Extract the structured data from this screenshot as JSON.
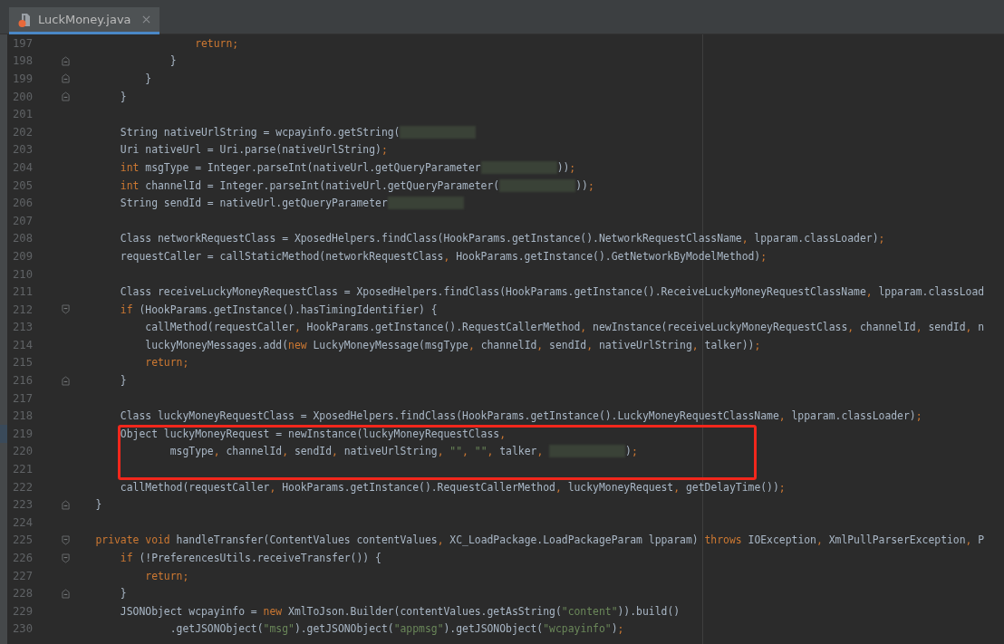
{
  "tab": {
    "title": "LuckMoney.java",
    "selected": true
  },
  "lines": [
    {
      "number": "197",
      "segments": [
        {
          "kind": "keyword",
          "text": "                    return"
        },
        {
          "kind": "punct",
          "text": ";"
        }
      ]
    },
    {
      "number": "198",
      "fold_close": true,
      "segments": [
        {
          "kind": "plain",
          "text": "                }"
        }
      ]
    },
    {
      "number": "199",
      "fold_close": true,
      "segments": [
        {
          "kind": "plain",
          "text": "            }"
        }
      ]
    },
    {
      "number": "200",
      "fold_close": true,
      "segments": [
        {
          "kind": "plain",
          "text": "        }"
        }
      ]
    },
    {
      "number": "201"
    },
    {
      "number": "202",
      "segments": [
        {
          "kind": "plain",
          "text": "        String nativeUrlString = wcpayinfo.getString("
        },
        {
          "kind": "redacted"
        }
      ]
    },
    {
      "number": "203",
      "segments": [
        {
          "kind": "plain",
          "text": "        Uri nativeUrl = Uri.parse(nativeUrlString)"
        },
        {
          "kind": "punct",
          "text": ";"
        }
      ]
    },
    {
      "number": "204",
      "segments": [
        {
          "kind": "keyword",
          "text": "        int"
        },
        {
          "kind": "plain",
          "text": " msgType = Integer.parseInt(nativeUrl.getQueryParameter"
        },
        {
          "kind": "redacted"
        },
        {
          "kind": "plain",
          "text": "))"
        },
        {
          "kind": "punct",
          "text": ";"
        }
      ]
    },
    {
      "number": "205",
      "segments": [
        {
          "kind": "keyword",
          "text": "        int"
        },
        {
          "kind": "plain",
          "text": " channelId = Integer.parseInt(nativeUrl.getQueryParameter("
        },
        {
          "kind": "redacted"
        },
        {
          "kind": "plain",
          "text": "))"
        },
        {
          "kind": "punct",
          "text": ";"
        }
      ]
    },
    {
      "number": "206",
      "segments": [
        {
          "kind": "plain",
          "text": "        String sendId = nativeUrl.getQueryParameter"
        },
        {
          "kind": "redacted"
        }
      ]
    },
    {
      "number": "207"
    },
    {
      "number": "208",
      "segments": [
        {
          "kind": "plain",
          "text": "        Class networkRequestClass = XposedHelpers.findClass(HookParams.getInstance().NetworkRequestClassName"
        },
        {
          "kind": "punct",
          "text": ","
        },
        {
          "kind": "plain",
          "text": " lpparam.classLoader)"
        },
        {
          "kind": "punct",
          "text": ";"
        }
      ]
    },
    {
      "number": "209",
      "segments": [
        {
          "kind": "plain",
          "text": "        requestCaller = callStaticMethod(networkRequestClass"
        },
        {
          "kind": "punct",
          "text": ","
        },
        {
          "kind": "plain",
          "text": " HookParams.getInstance().GetNetworkByModelMethod)"
        },
        {
          "kind": "punct",
          "text": ";"
        }
      ]
    },
    {
      "number": "210"
    },
    {
      "number": "211",
      "segments": [
        {
          "kind": "plain",
          "text": "        Class receiveLuckyMoneyRequestClass = XposedHelpers.findClass(HookParams.getInstance().ReceiveLuckyMoneyRequestClassName"
        },
        {
          "kind": "punct",
          "text": ","
        },
        {
          "kind": "plain",
          "text": " lpparam.classLoad"
        }
      ]
    },
    {
      "number": "212",
      "fold_open": true,
      "segments": [
        {
          "kind": "keyword",
          "text": "        if"
        },
        {
          "kind": "plain",
          "text": " (HookParams.getInstance().hasTimingIdentifier) {"
        }
      ]
    },
    {
      "number": "213",
      "segments": [
        {
          "kind": "plain",
          "text": "            callMethod(requestCaller"
        },
        {
          "kind": "punct",
          "text": ","
        },
        {
          "kind": "plain",
          "text": " HookParams.getInstance().RequestCallerMethod"
        },
        {
          "kind": "punct",
          "text": ","
        },
        {
          "kind": "plain",
          "text": " newInstance(receiveLuckyMoneyRequestClass"
        },
        {
          "kind": "punct",
          "text": ","
        },
        {
          "kind": "plain",
          "text": " channelId"
        },
        {
          "kind": "punct",
          "text": ","
        },
        {
          "kind": "plain",
          "text": " sendId"
        },
        {
          "kind": "punct",
          "text": ","
        },
        {
          "kind": "plain",
          "text": " n"
        }
      ]
    },
    {
      "number": "214",
      "segments": [
        {
          "kind": "plain",
          "text": "            luckyMoneyMessages.add("
        },
        {
          "kind": "keyword",
          "text": "new"
        },
        {
          "kind": "plain",
          "text": " LuckyMoneyMessage(msgType"
        },
        {
          "kind": "punct",
          "text": ","
        },
        {
          "kind": "plain",
          "text": " channelId"
        },
        {
          "kind": "punct",
          "text": ","
        },
        {
          "kind": "plain",
          "text": " sendId"
        },
        {
          "kind": "punct",
          "text": ","
        },
        {
          "kind": "plain",
          "text": " nativeUrlString"
        },
        {
          "kind": "punct",
          "text": ","
        },
        {
          "kind": "plain",
          "text": " talker))"
        },
        {
          "kind": "punct",
          "text": ";"
        }
      ]
    },
    {
      "number": "215",
      "segments": [
        {
          "kind": "keyword",
          "text": "            return"
        },
        {
          "kind": "punct",
          "text": ";"
        }
      ]
    },
    {
      "number": "216",
      "fold_close": true,
      "segments": [
        {
          "kind": "plain",
          "text": "        }"
        }
      ]
    },
    {
      "number": "217"
    },
    {
      "number": "218",
      "segments": [
        {
          "kind": "plain",
          "text": "        Class luckyMoneyRequestClass = XposedHelpers.findClass(HookParams.getInstance().LuckyMoneyRequestClassName"
        },
        {
          "kind": "punct",
          "text": ","
        },
        {
          "kind": "plain",
          "text": " lpparam.classLoader)"
        },
        {
          "kind": "punct",
          "text": ";"
        }
      ]
    },
    {
      "number": "219",
      "current": true,
      "boxed": true,
      "segments": [
        {
          "kind": "plain",
          "text": "        Object luckyMoneyRequest = newInstance(luckyMoneyRequestClass"
        },
        {
          "kind": "punct",
          "text": ","
        }
      ]
    },
    {
      "number": "220",
      "boxed": true,
      "segments": [
        {
          "kind": "plain",
          "text": "                msgType"
        },
        {
          "kind": "punct",
          "text": ","
        },
        {
          "kind": "plain",
          "text": " channelId"
        },
        {
          "kind": "punct",
          "text": ","
        },
        {
          "kind": "plain",
          "text": " sendId"
        },
        {
          "kind": "punct",
          "text": ","
        },
        {
          "kind": "plain",
          "text": " nativeUrlString"
        },
        {
          "kind": "punct",
          "text": ","
        },
        {
          "kind": "string",
          "text": " \"\""
        },
        {
          "kind": "punct",
          "text": ","
        },
        {
          "kind": "string",
          "text": " \"\""
        },
        {
          "kind": "punct",
          "text": ","
        },
        {
          "kind": "plain",
          "text": " talker"
        },
        {
          "kind": "punct",
          "text": ", "
        },
        {
          "kind": "redacted"
        },
        {
          "kind": "plain",
          "text": ")"
        },
        {
          "kind": "punct",
          "text": ";"
        }
      ]
    },
    {
      "number": "221",
      "boxed": true
    },
    {
      "number": "222",
      "segments": [
        {
          "kind": "plain",
          "text": "        callMethod(requestCaller"
        },
        {
          "kind": "punct",
          "text": ","
        },
        {
          "kind": "plain",
          "text": " HookParams.getInstance().RequestCallerMethod"
        },
        {
          "kind": "punct",
          "text": ","
        },
        {
          "kind": "plain",
          "text": " luckyMoneyRequest"
        },
        {
          "kind": "punct",
          "text": ","
        },
        {
          "kind": "plain",
          "text": " getDelayTime())"
        },
        {
          "kind": "punct",
          "text": ";"
        }
      ]
    },
    {
      "number": "223",
      "fold_close": true,
      "segments": [
        {
          "kind": "plain",
          "text": "    }"
        }
      ]
    },
    {
      "number": "224"
    },
    {
      "number": "225",
      "fold_open": true,
      "segments": [
        {
          "kind": "keyword",
          "text": "    private void"
        },
        {
          "kind": "plain",
          "text": " handleTransfer(ContentValues contentValues"
        },
        {
          "kind": "punct",
          "text": ","
        },
        {
          "kind": "plain",
          "text": " XC_LoadPackage.LoadPackageParam lpparam) "
        },
        {
          "kind": "keyword",
          "text": "throws"
        },
        {
          "kind": "plain",
          "text": " IOException"
        },
        {
          "kind": "punct",
          "text": ","
        },
        {
          "kind": "plain",
          "text": " XmlPullParserException"
        },
        {
          "kind": "punct",
          "text": ","
        },
        {
          "kind": "plain",
          "text": " P"
        }
      ]
    },
    {
      "number": "226",
      "fold_open": true,
      "segments": [
        {
          "kind": "keyword",
          "text": "        if"
        },
        {
          "kind": "plain",
          "text": " (!PreferencesUtils.receiveTransfer()) {"
        }
      ]
    },
    {
      "number": "227",
      "segments": [
        {
          "kind": "keyword",
          "text": "            return"
        },
        {
          "kind": "punct",
          "text": ";"
        }
      ]
    },
    {
      "number": "228",
      "fold_close": true,
      "segments": [
        {
          "kind": "plain",
          "text": "        }"
        }
      ]
    },
    {
      "number": "229",
      "segments": [
        {
          "kind": "plain",
          "text": "        JSONObject wcpayinfo = "
        },
        {
          "kind": "keyword",
          "text": "new"
        },
        {
          "kind": "plain",
          "text": " XmlToJson.Builder(contentValues.getAsString("
        },
        {
          "kind": "string",
          "text": "\"content\""
        },
        {
          "kind": "plain",
          "text": ")).build()"
        }
      ]
    },
    {
      "number": "230",
      "segments": [
        {
          "kind": "plain",
          "text": "                .getJSONObject("
        },
        {
          "kind": "string",
          "text": "\"msg\""
        },
        {
          "kind": "plain",
          "text": ").getJSONObject("
        },
        {
          "kind": "string",
          "text": "\"appmsg\""
        },
        {
          "kind": "plain",
          "text": ").getJSONObject("
        },
        {
          "kind": "string",
          "text": "\"wcpayinfo\""
        },
        {
          "kind": "plain",
          "text": ")"
        },
        {
          "kind": "punct",
          "text": ";"
        }
      ]
    }
  ]
}
